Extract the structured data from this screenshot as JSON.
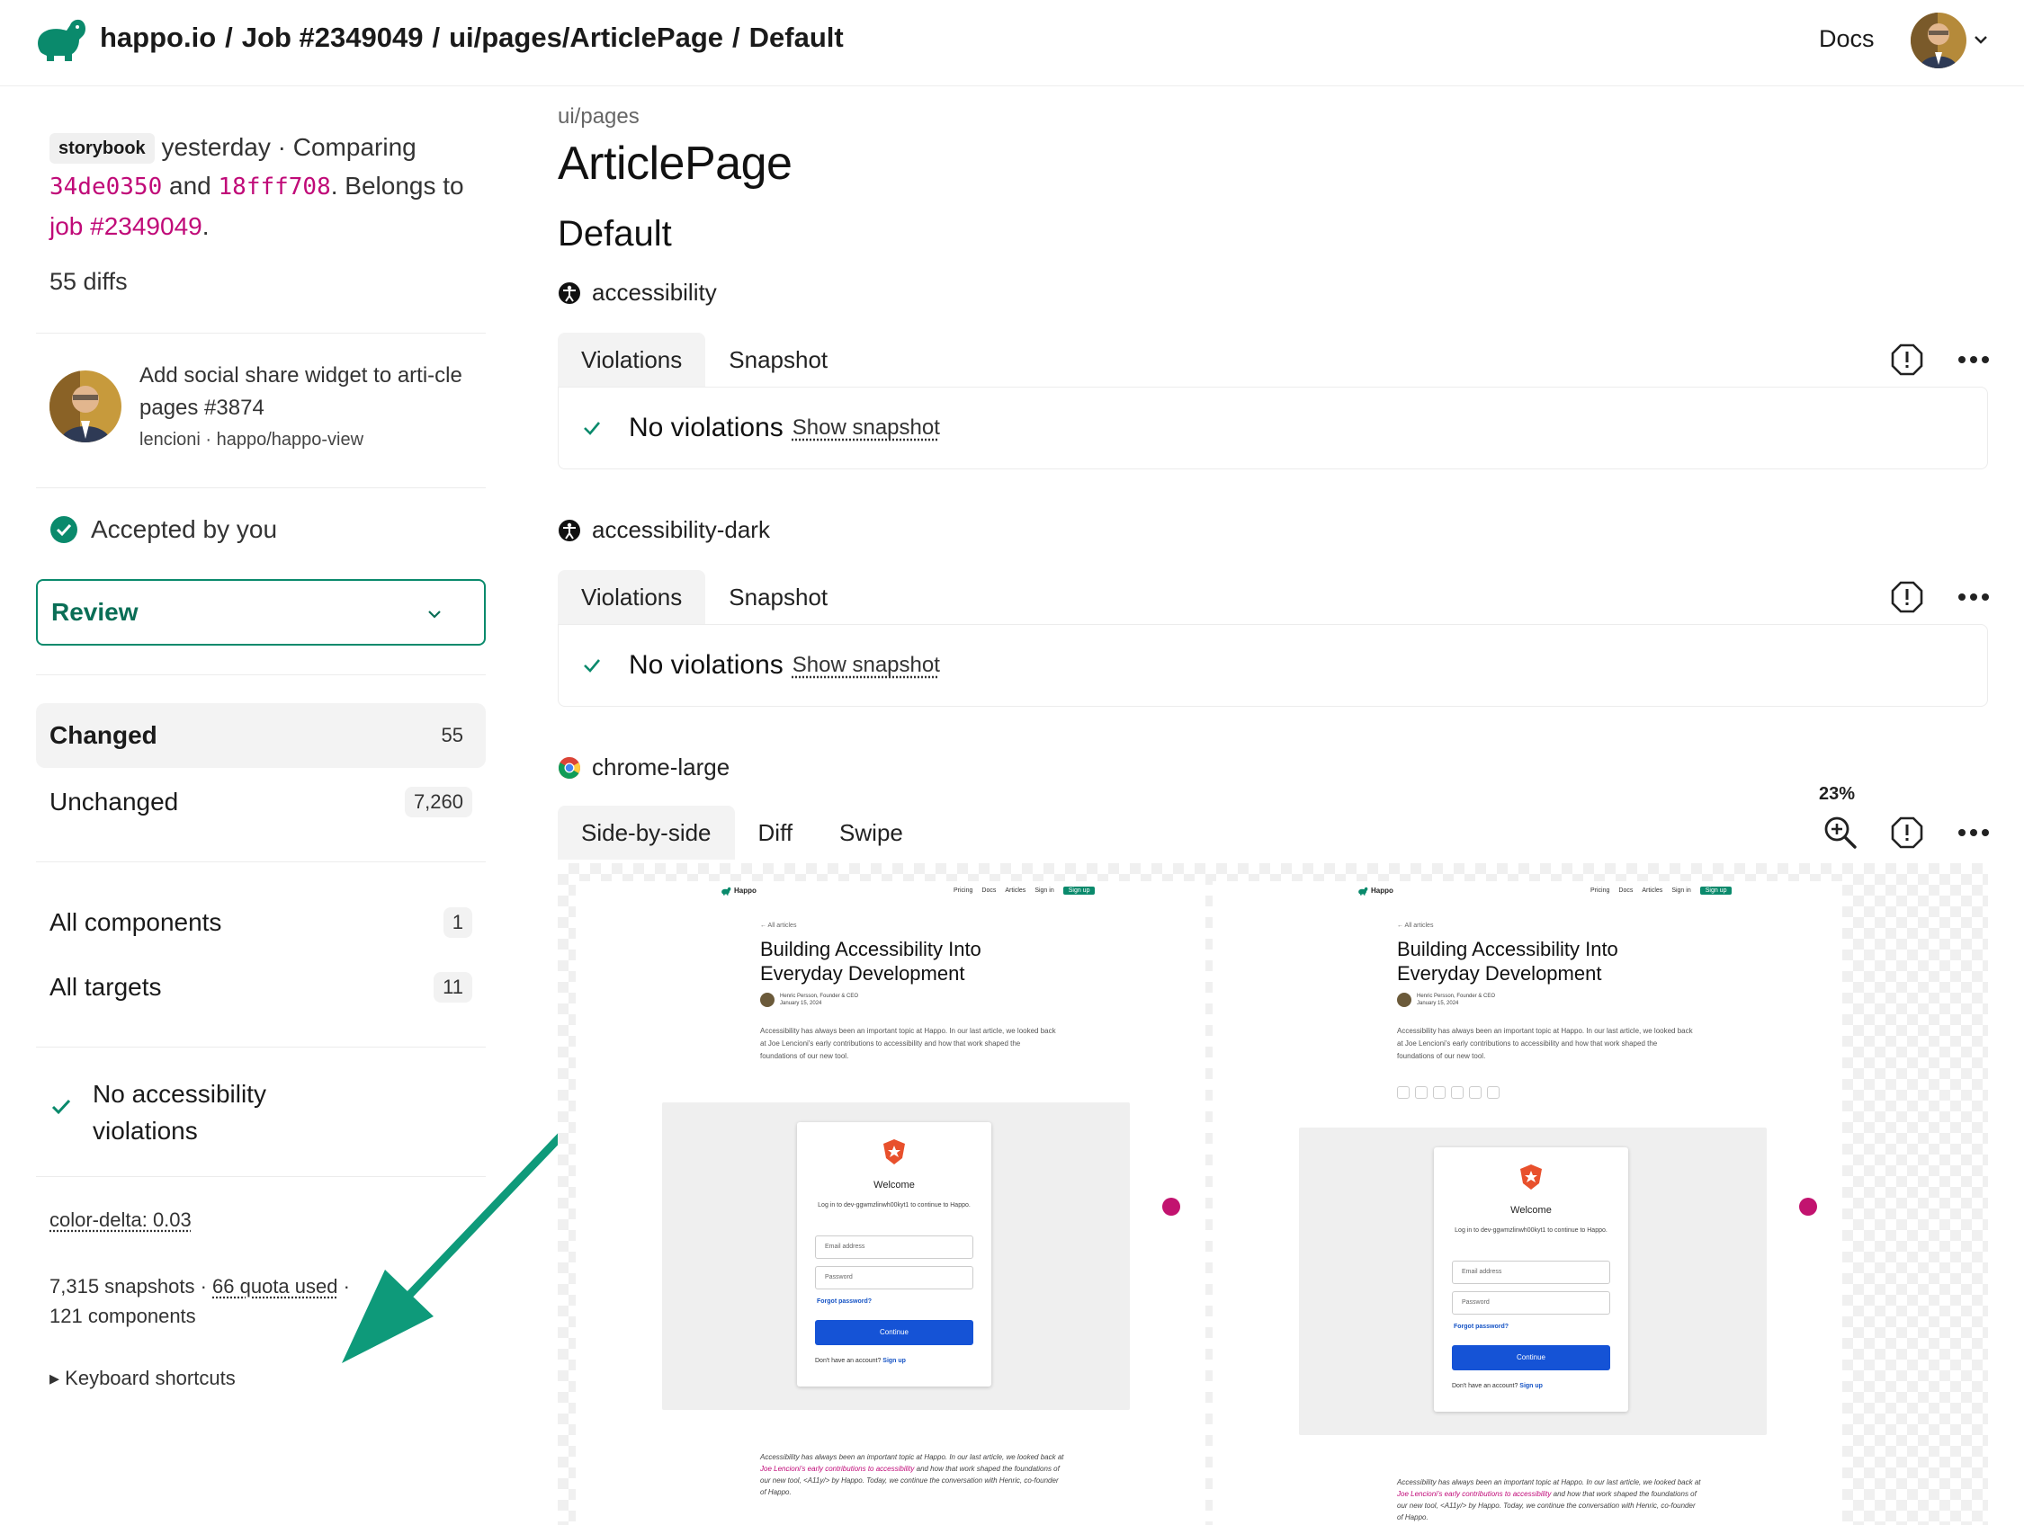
{
  "header": {
    "breadcrumbs": [
      "happo.io",
      "Job #2349049",
      "ui/pages/ArticlePage",
      "Default"
    ],
    "separator": "/",
    "docs_label": "Docs"
  },
  "sidebar": {
    "chip": "storybook",
    "when": "yesterday",
    "comparing_text": "· Comparing",
    "sha_before": "34de0350",
    "and_text": "and",
    "sha_after": "18fff708",
    "belongs_text": ". Belongs to",
    "job_link": "job #2349049",
    "diffs": "55 diffs",
    "pr": {
      "title": "Add social share widget to arti-cle pages #3874",
      "author": "lencioni",
      "repo": "happo/happo-view"
    },
    "status": "Accepted by you",
    "review_label": "Review",
    "nav": [
      {
        "label": "Changed",
        "count": "55"
      },
      {
        "label": "Unchanged",
        "count": "7,260"
      },
      {
        "label": "All components",
        "count": "1"
      },
      {
        "label": "All targets",
        "count": "11"
      }
    ],
    "a11y_line1": "No accessibility",
    "a11y_line2": "violations",
    "color_delta": "color-delta: 0.03",
    "stats_snapshots": "7,315 snapshots",
    "stats_quota": "66 quota used",
    "stats_components": "121 components",
    "shortcuts": "▸ Keyboard shortcuts"
  },
  "main": {
    "path": "ui/pages",
    "component": "ArticlePage",
    "variant": "Default",
    "targets": [
      {
        "name": "accessibility",
        "tabs": [
          "Violations",
          "Snapshot"
        ],
        "result": "No violations",
        "link": "Show snapshot"
      },
      {
        "name": "accessibility-dark",
        "tabs": [
          "Violations",
          "Snapshot"
        ],
        "result": "No violations",
        "link": "Show snapshot"
      },
      {
        "name": "chrome-large",
        "tabs": [
          "Side-by-side",
          "Diff",
          "Swipe"
        ],
        "zoom": "23%"
      }
    ]
  },
  "preview": {
    "brand": "Happo",
    "nav_links": [
      "Pricing",
      "Docs",
      "Articles",
      "Sign in"
    ],
    "signup": "Sign up",
    "back": "← All articles",
    "title": "Building Accessibility Into Everyday Development",
    "author_name": "Henric Persson, Founder & CEO",
    "author_date": "January 15, 2024",
    "intro": "Accessibility has always been an important topic at Happo. In our last article, we looked back at Joe Lencioni's early contributions to accessibility and how that work shaped the foundations of our new tool.",
    "login_welcome": "Welcome",
    "login_sub": "Log in to dev-ggwmzlinwh00kyt1 to continue to Happo.",
    "email_placeholder": "Email address",
    "password_placeholder": "Password",
    "forgot": "Forgot password?",
    "continue": "Continue",
    "no_account": "Don't have an account?",
    "sign_up_link": "Sign up",
    "quote_a": "Accessibility has always been an important topic at Happo. In our last article, we looked back at ",
    "quote_link": "Joe Lencioni's early contributions to accessibility",
    "quote_b": " and how that work shaped the foundations of our new tool, <A11y/> by Happo. Today, we continue the conversation with Henric, co-founder of Happo."
  },
  "colors": {
    "accent": "#0a8a6c",
    "sha": "#c00a78",
    "primary_button": "#1553d6"
  }
}
